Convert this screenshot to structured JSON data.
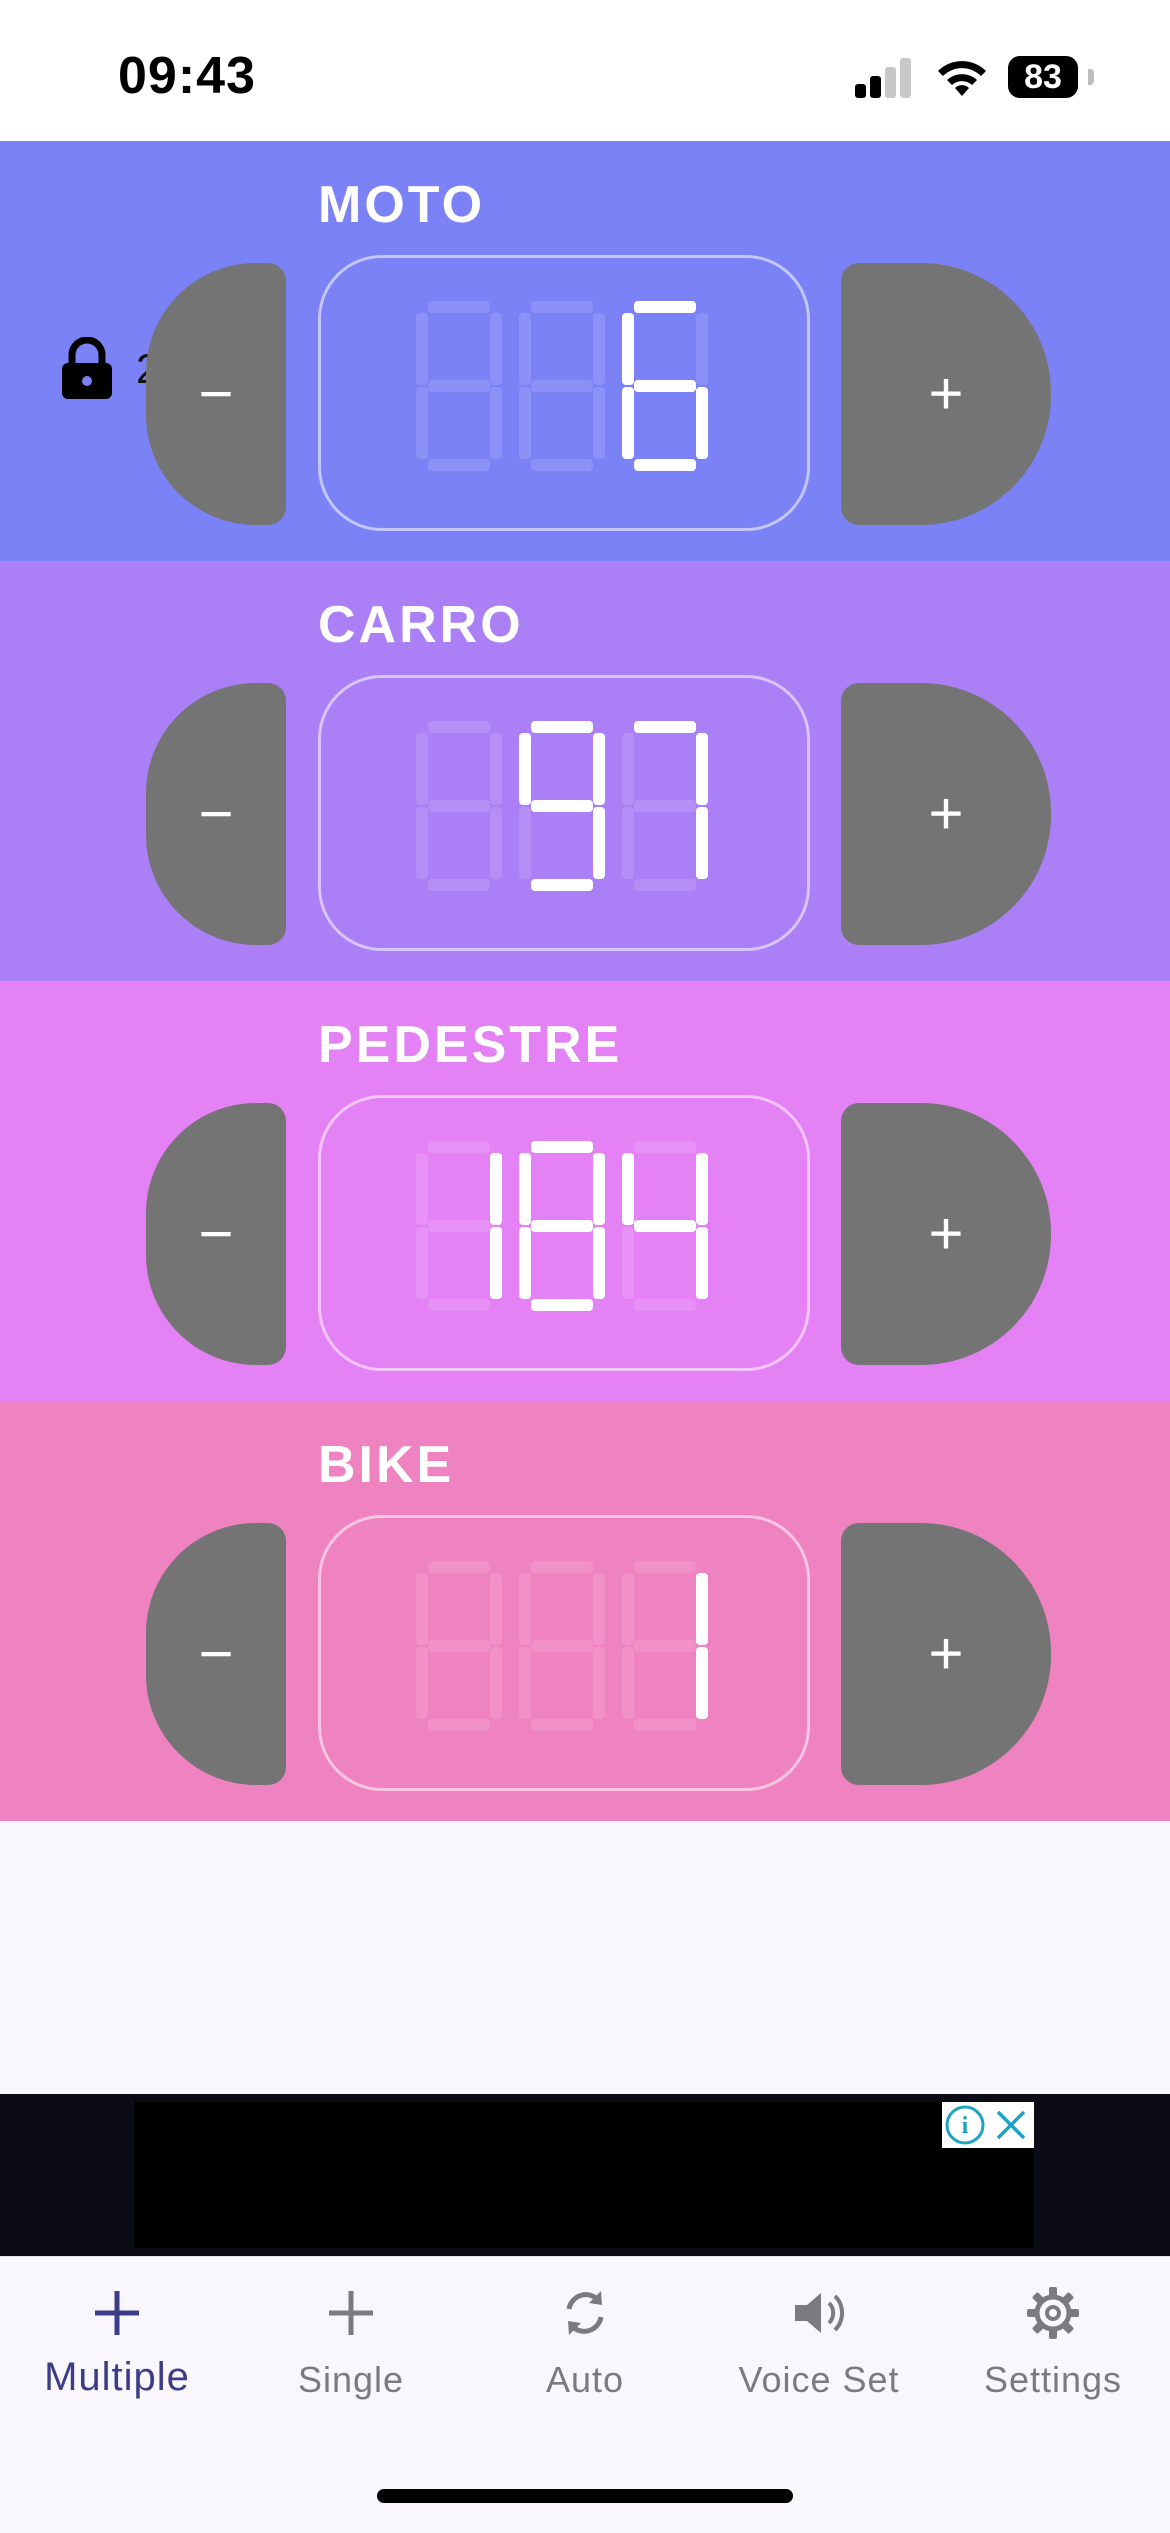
{
  "status_bar": {
    "time": "09:43",
    "battery": "83"
  },
  "lock": {
    "count": "288"
  },
  "counters": [
    {
      "label": "MOTO",
      "value": "6",
      "digits": [
        "",
        "",
        "6"
      ],
      "color": "#7b82f5"
    },
    {
      "label": "CARRO",
      "value": "97",
      "digits": [
        "",
        "9",
        "7"
      ],
      "color": "#ab7ff5"
    },
    {
      "label": "PEDESTRE",
      "value": "184",
      "digits": [
        "1",
        "8",
        "4"
      ],
      "color": "#e481f5"
    },
    {
      "label": "BIKE",
      "value": "1",
      "digits": [
        "",
        "",
        "1"
      ],
      "color": "#ef82c0"
    }
  ],
  "buttons": {
    "minus": "−",
    "plus": "+"
  },
  "ad": {
    "info_glyph": "i",
    "close_glyph": "✕"
  },
  "tabs": [
    {
      "label": "Multiple",
      "icon": "plus-icon",
      "active": true
    },
    {
      "label": "Single",
      "icon": "plus-icon",
      "active": false
    },
    {
      "label": "Auto",
      "icon": "refresh-icon",
      "active": false
    },
    {
      "label": "Voice Set",
      "icon": "speaker-icon",
      "active": false
    },
    {
      "label": "Settings",
      "icon": "gear-icon",
      "active": false
    }
  ],
  "colors": {
    "active_tab": "#3c3c88",
    "inactive_tab": "#7b7b7f",
    "button": "#747474"
  }
}
